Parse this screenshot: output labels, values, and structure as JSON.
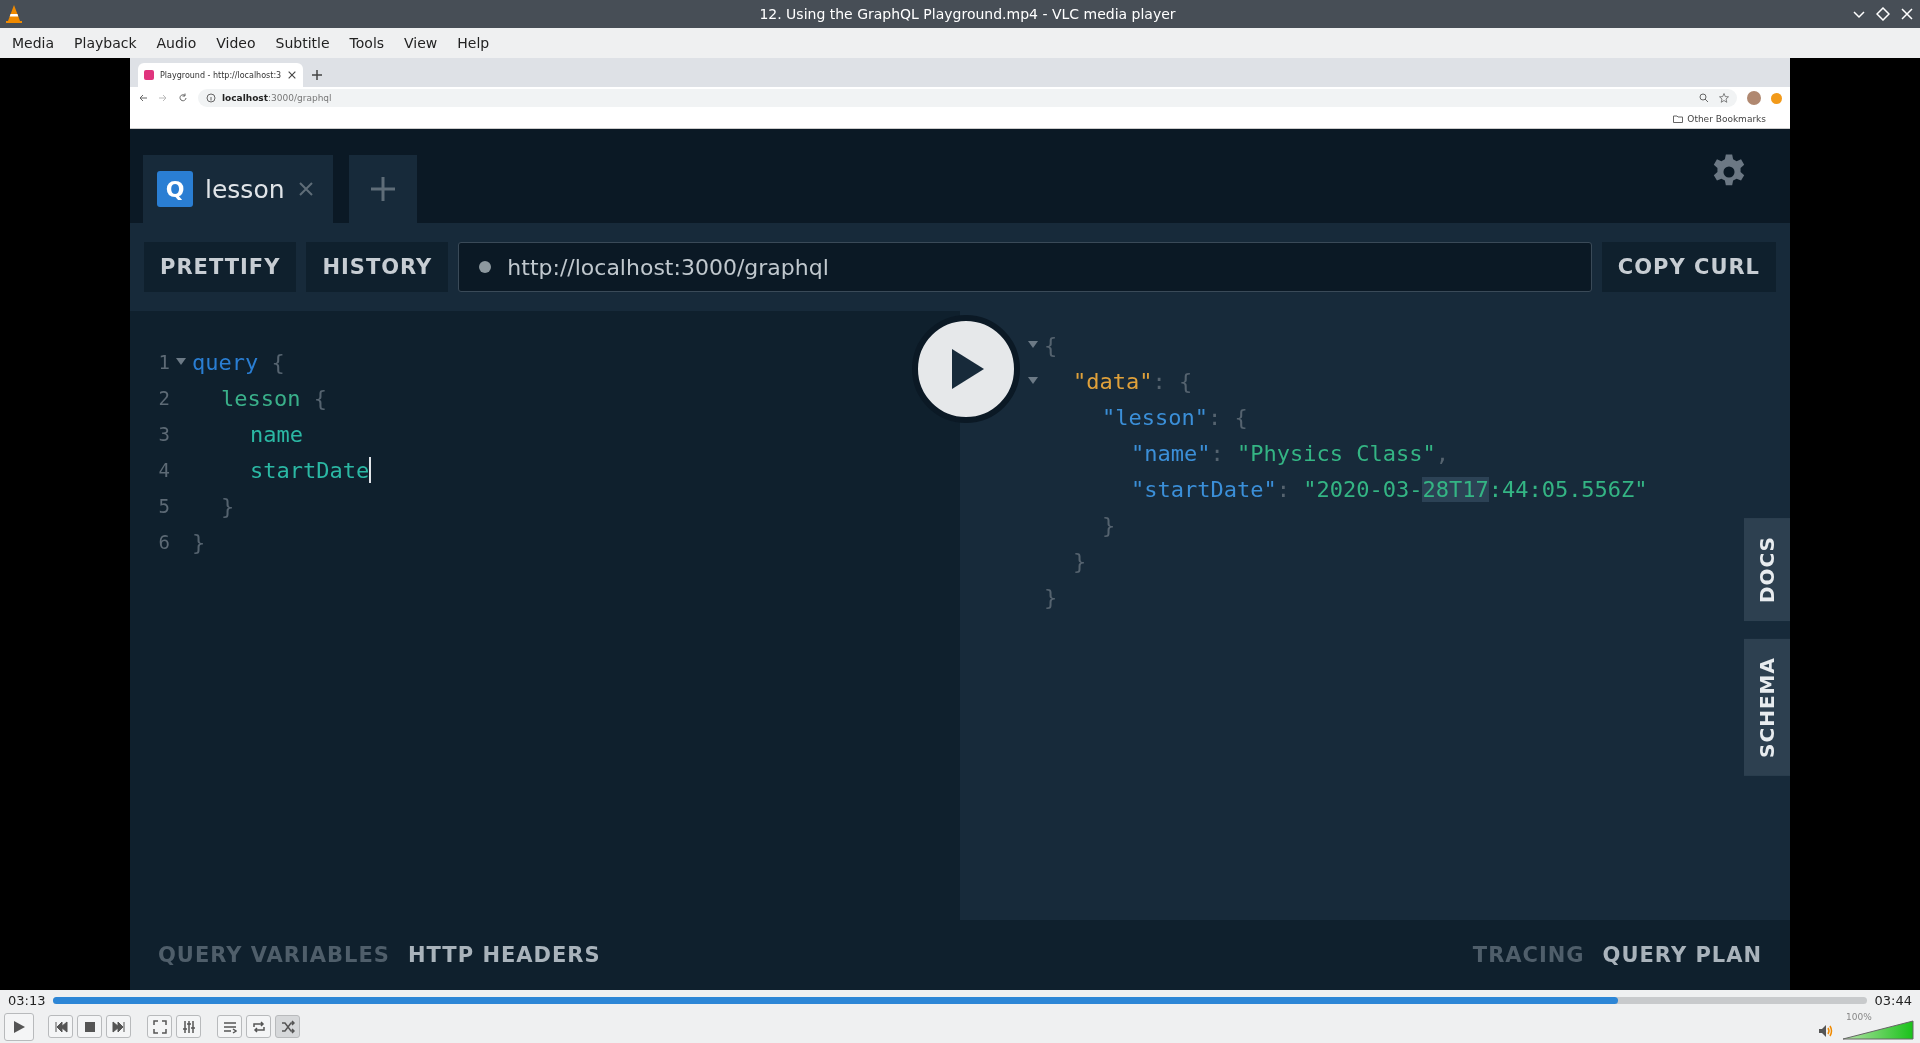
{
  "window": {
    "title": "12. Using the GraphQL Playground.mp4 - VLC media player"
  },
  "menu": [
    "Media",
    "Playback",
    "Audio",
    "Video",
    "Subtitle",
    "Tools",
    "View",
    "Help"
  ],
  "browser": {
    "tab": {
      "title": "Playground - http://localhost:3"
    },
    "address": "**localhost**:3000/graphql",
    "bookmarks": "Other Bookmarks"
  },
  "playground": {
    "tabs": [
      {
        "badge": "Q",
        "label": "lesson",
        "selected": true
      }
    ],
    "buttons": [
      "PRETTIFY",
      "HISTORY"
    ],
    "endpoint": "http://localhost:3000/graphql",
    "copy_button": "COPY CURL",
    "query": [
      {
        "number": "1",
        "expanded": true,
        "tokens": [
          {
            "kind": "keyword",
            "text": "query"
          },
          {
            "kind": "punct",
            "text": " {"
          }
        ],
        "children": [
          {
            "number": "2",
            "tokens": [
              {
                "kind": "field",
                "text": "lesson"
              },
              {
                "kind": "punct",
                "text": " {"
              }
            ],
            "children": [
              {
                "number": "3",
                "tokens": [
                  {
                    "kind": "subfield",
                    "text": "name"
                  }
                ]
              },
              {
                "number": "4",
                "caret": true,
                "tokens": [
                  {
                    "kind": "subfield",
                    "text": "startDate"
                  }
                ]
              }
            ]
          },
          {
            "number": "5",
            "tokens": [
              {
                "kind": "punct",
                "text": "}"
              }
            ]
          }
        ]
      },
      {
        "number": "6",
        "tokens": [
          {
            "kind": "punct",
            "text": "}"
          }
        ]
      }
    ],
    "result": [
      {
        "expanded": true,
        "tokens": [
          {
            "kind": "punct",
            "text": "{"
          }
        ],
        "children": [
          {
            "expanded": true,
            "tokens": [
              {
                "kind": "key",
                "text": "\"data\""
              },
              {
                "kind": "punct",
                "text": ": {"
              }
            ],
            "children": [
              {
                "tokens": [
                  {
                    "kind": "key2",
                    "text": "\"lesson\""
                  },
                  {
                    "kind": "punct",
                    "text": ": {"
                  }
                ],
                "children": [
                  {
                    "tokens": [
                      {
                        "kind": "key2",
                        "text": "\"name\""
                      },
                      {
                        "kind": "punct",
                        "text": ": "
                      },
                      {
                        "kind": "string",
                        "text": "\"Physics Class\""
                      },
                      {
                        "kind": "punct",
                        "text": ","
                      }
                    ]
                  },
                  {
                    "tokens": [
                      {
                        "kind": "key2",
                        "text": "\"startDate\""
                      },
                      {
                        "kind": "punct",
                        "text": ": "
                      },
                      {
                        "kind": "string",
                        "text": "\"2020-03-"
                      },
                      {
                        "kind": "string",
                        "text": "28T17",
                        "selected": true
                      },
                      {
                        "kind": "string",
                        "text": ":44:05.556Z\""
                      }
                    ]
                  }
                ]
              },
              {
                "tokens": [
                  {
                    "kind": "punct",
                    "text": "}"
                  }
                ]
              }
            ]
          },
          {
            "tokens": [
              {
                "kind": "punct",
                "text": "}"
              }
            ]
          }
        ]
      },
      {
        "tokens": [
          {
            "kind": "punct",
            "text": "}"
          }
        ]
      }
    ],
    "side_tabs": [
      "DOCS",
      "SCHEMA"
    ],
    "bottom_left": [
      {
        "label": "QUERY VARIABLES",
        "selected": false
      },
      {
        "label": "HTTP HEADERS",
        "selected": true
      }
    ],
    "bottom_right": [
      {
        "label": "TRACING",
        "selected": false
      },
      {
        "label": "QUERY PLAN",
        "selected": true
      }
    ]
  },
  "player": {
    "elapsed": "03:13",
    "total": "03:44",
    "progress": {
      "level": 0.863
    },
    "volume": {
      "level": 1.0,
      "reading": "100%"
    }
  }
}
